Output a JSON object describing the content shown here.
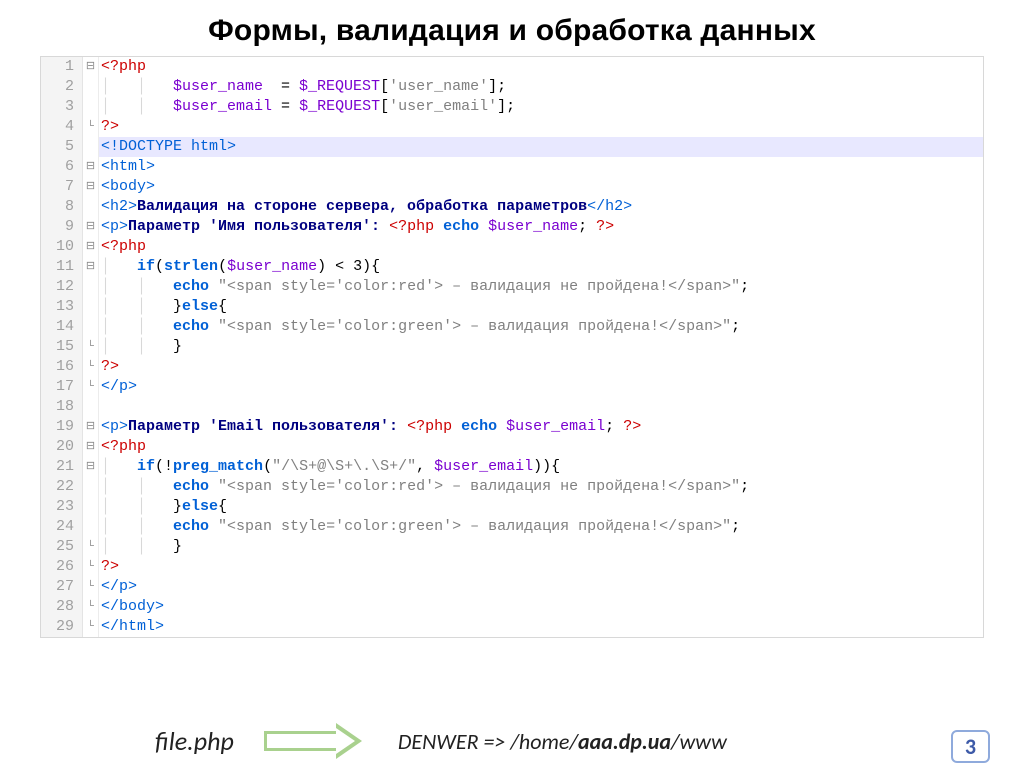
{
  "title": "Формы, валидация и обработка данных",
  "lines": [
    {
      "num": 1,
      "fold": "⊟",
      "hl": false,
      "tokens": [
        [
          "c-red",
          "<?php"
        ]
      ]
    },
    {
      "num": 2,
      "fold": "",
      "hl": false,
      "tokens": [
        [
          "guide",
          "│   │   "
        ],
        [
          "c-purple",
          "$user_name"
        ],
        [
          "c-black",
          "  = "
        ],
        [
          "c-purple",
          "$_REQUEST"
        ],
        [
          "c-black",
          "["
        ],
        [
          "c-gray",
          "'user_name'"
        ],
        [
          "c-black",
          "];"
        ]
      ]
    },
    {
      "num": 3,
      "fold": "",
      "hl": false,
      "tokens": [
        [
          "guide",
          "│   │   "
        ],
        [
          "c-purple",
          "$user_email"
        ],
        [
          "c-black",
          " = "
        ],
        [
          "c-purple",
          "$_REQUEST"
        ],
        [
          "c-black",
          "["
        ],
        [
          "c-gray",
          "'user_email'"
        ],
        [
          "c-black",
          "];"
        ]
      ]
    },
    {
      "num": 4,
      "fold": "└",
      "hl": false,
      "tokens": [
        [
          "c-red",
          "?>"
        ]
      ]
    },
    {
      "num": 5,
      "fold": "",
      "hl": true,
      "tokens": [
        [
          "c-blue",
          "<!DOCTYPE html>"
        ]
      ]
    },
    {
      "num": 6,
      "fold": "⊟",
      "hl": false,
      "tokens": [
        [
          "c-blue",
          "<html>"
        ]
      ]
    },
    {
      "num": 7,
      "fold": "⊟",
      "hl": false,
      "tokens": [
        [
          "c-blue",
          "<body>"
        ]
      ]
    },
    {
      "num": 8,
      "fold": "",
      "hl": false,
      "tokens": [
        [
          "c-blue",
          "<h2>"
        ],
        [
          "c-navy",
          "Валидация на стороне сервера, обработка параметров"
        ],
        [
          "c-blue",
          "</h2>"
        ]
      ]
    },
    {
      "num": 9,
      "fold": "⊟",
      "hl": false,
      "tokens": [
        [
          "c-blue",
          "<p>"
        ],
        [
          "c-navy",
          "Параметр 'Имя пользователя':"
        ],
        [
          "c-black",
          " "
        ],
        [
          "c-red",
          "<?php"
        ],
        [
          "c-black",
          " "
        ],
        [
          "c-blue bold",
          "echo"
        ],
        [
          "c-black",
          " "
        ],
        [
          "c-purple",
          "$user_name"
        ],
        [
          "c-black",
          "; "
        ],
        [
          "c-red",
          "?>"
        ]
      ]
    },
    {
      "num": 10,
      "fold": "⊟",
      "hl": false,
      "tokens": [
        [
          "c-red",
          "<?php"
        ]
      ]
    },
    {
      "num": 11,
      "fold": "⊟",
      "hl": false,
      "tokens": [
        [
          "guide",
          "│   "
        ],
        [
          "c-blue bold",
          "if"
        ],
        [
          "c-black",
          "("
        ],
        [
          "c-blue bold",
          "strlen"
        ],
        [
          "c-black",
          "("
        ],
        [
          "c-purple",
          "$user_name"
        ],
        [
          "c-black",
          ") < 3){"
        ]
      ]
    },
    {
      "num": 12,
      "fold": "",
      "hl": false,
      "tokens": [
        [
          "guide",
          "│   │   "
        ],
        [
          "c-blue bold",
          "echo"
        ],
        [
          "c-black",
          " "
        ],
        [
          "c-gray",
          "\"<span style='color:red'> – валидация не пройдена!</span>\""
        ],
        [
          "c-black",
          ";"
        ]
      ]
    },
    {
      "num": 13,
      "fold": "",
      "hl": false,
      "tokens": [
        [
          "guide",
          "│   │   "
        ],
        [
          "c-black",
          "}"
        ],
        [
          "c-blue bold",
          "else"
        ],
        [
          "c-black",
          "{"
        ]
      ]
    },
    {
      "num": 14,
      "fold": "",
      "hl": false,
      "tokens": [
        [
          "guide",
          "│   │   "
        ],
        [
          "c-blue bold",
          "echo"
        ],
        [
          "c-black",
          " "
        ],
        [
          "c-gray",
          "\"<span style='color:green'> – валидация пройдена!</span>\""
        ],
        [
          "c-black",
          ";"
        ]
      ]
    },
    {
      "num": 15,
      "fold": "└",
      "hl": false,
      "tokens": [
        [
          "guide",
          "│   │   "
        ],
        [
          "c-black",
          "}"
        ]
      ]
    },
    {
      "num": 16,
      "fold": "└",
      "hl": false,
      "tokens": [
        [
          "c-red",
          "?>"
        ]
      ]
    },
    {
      "num": 17,
      "fold": "└",
      "hl": false,
      "tokens": [
        [
          "c-blue",
          "</p>"
        ]
      ]
    },
    {
      "num": 18,
      "fold": "",
      "hl": false,
      "tokens": []
    },
    {
      "num": 19,
      "fold": "⊟",
      "hl": false,
      "tokens": [
        [
          "c-blue",
          "<p>"
        ],
        [
          "c-navy",
          "Параметр 'Email пользователя':"
        ],
        [
          "c-black",
          " "
        ],
        [
          "c-red",
          "<?php"
        ],
        [
          "c-black",
          " "
        ],
        [
          "c-blue bold",
          "echo"
        ],
        [
          "c-black",
          " "
        ],
        [
          "c-purple",
          "$user_email"
        ],
        [
          "c-black",
          "; "
        ],
        [
          "c-red",
          "?>"
        ]
      ]
    },
    {
      "num": 20,
      "fold": "⊟",
      "hl": false,
      "tokens": [
        [
          "c-red",
          "<?php"
        ]
      ]
    },
    {
      "num": 21,
      "fold": "⊟",
      "hl": false,
      "tokens": [
        [
          "guide",
          "│   "
        ],
        [
          "c-blue bold",
          "if"
        ],
        [
          "c-black",
          "(!"
        ],
        [
          "c-blue bold",
          "preg_match"
        ],
        [
          "c-black",
          "("
        ],
        [
          "c-gray",
          "\"/\\S+@\\S+\\.\\S+/\""
        ],
        [
          "c-black",
          ", "
        ],
        [
          "c-purple",
          "$user_email"
        ],
        [
          "c-black",
          ")){"
        ]
      ]
    },
    {
      "num": 22,
      "fold": "",
      "hl": false,
      "tokens": [
        [
          "guide",
          "│   │   "
        ],
        [
          "c-blue bold",
          "echo"
        ],
        [
          "c-black",
          " "
        ],
        [
          "c-gray",
          "\"<span style='color:red'> – валидация не пройдена!</span>\""
        ],
        [
          "c-black",
          ";"
        ]
      ]
    },
    {
      "num": 23,
      "fold": "",
      "hl": false,
      "tokens": [
        [
          "guide",
          "│   │   "
        ],
        [
          "c-black",
          "}"
        ],
        [
          "c-blue bold",
          "else"
        ],
        [
          "c-black",
          "{"
        ]
      ]
    },
    {
      "num": 24,
      "fold": "",
      "hl": false,
      "tokens": [
        [
          "guide",
          "│   │   "
        ],
        [
          "c-blue bold",
          "echo"
        ],
        [
          "c-black",
          " "
        ],
        [
          "c-gray",
          "\"<span style='color:green'> – валидация пройдена!</span>\""
        ],
        [
          "c-black",
          ";"
        ]
      ]
    },
    {
      "num": 25,
      "fold": "└",
      "hl": false,
      "tokens": [
        [
          "guide",
          "│   │   "
        ],
        [
          "c-black",
          "}"
        ]
      ]
    },
    {
      "num": 26,
      "fold": "└",
      "hl": false,
      "tokens": [
        [
          "c-red",
          "?>"
        ]
      ]
    },
    {
      "num": 27,
      "fold": "└",
      "hl": false,
      "tokens": [
        [
          "c-blue",
          "</p>"
        ]
      ]
    },
    {
      "num": 28,
      "fold": "└",
      "hl": false,
      "tokens": [
        [
          "c-blue",
          "</body>"
        ]
      ]
    },
    {
      "num": 29,
      "fold": "└",
      "hl": false,
      "tokens": [
        [
          "c-blue",
          "</html>"
        ]
      ]
    }
  ],
  "footer": {
    "filename": "file.php",
    "path_prefix": "DENWER => /home/",
    "path_bold": "aaa.dp.ua",
    "path_suffix": "/www"
  },
  "page_number": "3"
}
